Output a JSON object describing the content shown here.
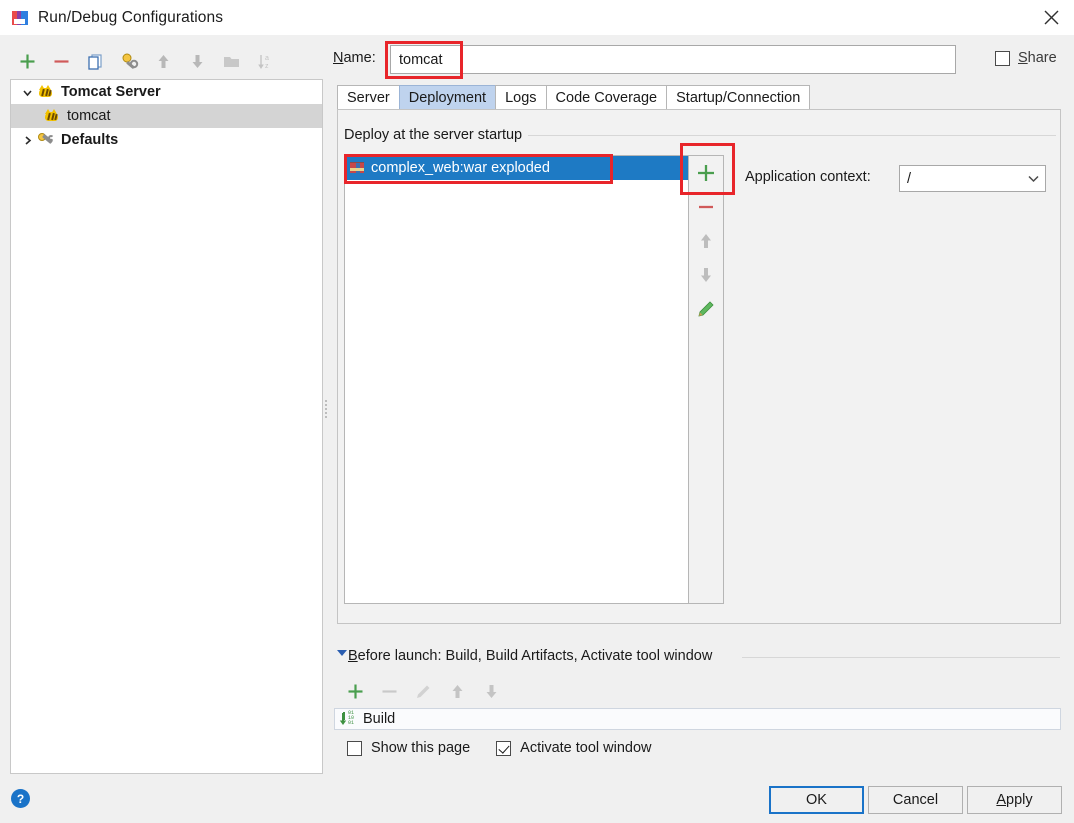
{
  "window": {
    "title": "Run/Debug Configurations",
    "icon": "intellij-icon",
    "close_label": "✕"
  },
  "left_toolbar": {
    "buttons": [
      {
        "name": "add-configuration-button",
        "icon": "plus-icon",
        "tip": "Add New Configuration"
      },
      {
        "name": "remove-configuration-button",
        "icon": "minus-icon",
        "tip": "Remove Configuration"
      },
      {
        "name": "copy-configuration-button",
        "icon": "copy-icon",
        "tip": "Copy Configuration"
      },
      {
        "name": "edit-defaults-button",
        "icon": "wrench-bulb-icon",
        "tip": "Edit defaults"
      },
      {
        "name": "move-up-button",
        "icon": "arrow-up-icon",
        "tip": "Move Up"
      },
      {
        "name": "move-down-button",
        "icon": "arrow-down-icon",
        "tip": "Move Down"
      },
      {
        "name": "create-folder-button",
        "icon": "folder-icon",
        "tip": "Create New Folder"
      },
      {
        "name": "sort-configurations-button",
        "icon": "sort-az-icon",
        "tip": "Sort Configurations"
      }
    ]
  },
  "tree": {
    "nodes": [
      {
        "label": "Tomcat Server",
        "icon": "tomcat-icon",
        "expanded": true,
        "bold": true,
        "indent": 0,
        "selected": false,
        "twisty": "⌄"
      },
      {
        "label": "tomcat",
        "icon": "tomcat-icon",
        "expanded": null,
        "bold": false,
        "indent": 1,
        "selected": true,
        "twisty": ""
      },
      {
        "label": "Defaults",
        "icon": "wrench-bulb-icon",
        "expanded": false,
        "bold": true,
        "indent": 0,
        "selected": false,
        "twisty": "›"
      }
    ]
  },
  "name_row": {
    "label_prefix": "",
    "label_mnemonic": "N",
    "label_suffix": "ame:",
    "value": "tomcat",
    "placeholder": ""
  },
  "share": {
    "label_mnemonic": "S",
    "label_suffix": "hare",
    "checked": false
  },
  "tabs": [
    {
      "label": "Server",
      "active": false
    },
    {
      "label": "Deployment",
      "active": true
    },
    {
      "label": "Logs",
      "active": false
    },
    {
      "label": "Code Coverage",
      "active": false
    },
    {
      "label": "Startup/Connection",
      "active": false
    }
  ],
  "deployment": {
    "group_title": "Deploy at the server startup",
    "items": [
      {
        "label": "complex_web:war exploded",
        "icon": "artifact-icon",
        "selected": true
      }
    ],
    "side_toolbar": [
      {
        "name": "add-artifact-button",
        "icon": "plus-icon",
        "enabled": true
      },
      {
        "name": "remove-artifact-button",
        "icon": "minus-icon",
        "enabled": true
      },
      {
        "name": "move-artifact-up-button",
        "icon": "arrow-up-icon",
        "enabled": false
      },
      {
        "name": "move-artifact-down-button",
        "icon": "arrow-down-icon",
        "enabled": false
      },
      {
        "name": "edit-artifact-button",
        "icon": "pencil-icon",
        "enabled": true
      }
    ],
    "application_context": {
      "label": "Application context:",
      "value": "/",
      "options": [
        "/"
      ]
    }
  },
  "before_launch": {
    "twisty": "▾",
    "title_mnemonic": "B",
    "title_suffix": "efore launch: Build, Build Artifacts, Activate tool window",
    "toolbar": [
      {
        "name": "add-task-button",
        "icon": "plus-icon",
        "enabled": true
      },
      {
        "name": "remove-task-button",
        "icon": "minus-icon",
        "enabled": false
      },
      {
        "name": "edit-task-button",
        "icon": "pencil-icon",
        "enabled": false
      },
      {
        "name": "move-task-up-button",
        "icon": "arrow-up-icon",
        "enabled": false
      },
      {
        "name": "move-task-down-button",
        "icon": "arrow-down-icon",
        "enabled": false
      }
    ],
    "tasks": [
      {
        "label": "Build",
        "icon": "build-icon"
      }
    ],
    "checkboxes": [
      {
        "name": "show-this-page-checkbox",
        "label": "Show this page",
        "checked": false
      },
      {
        "name": "activate-tool-window-checkbox",
        "label": "Activate tool window",
        "checked": true
      }
    ]
  },
  "footer": {
    "help_glyph": "?",
    "ok": {
      "label": "OK",
      "default": true
    },
    "cancel": {
      "label": "Cancel",
      "default": false
    },
    "apply": {
      "label_mnemonic": "A",
      "label_suffix": "pply",
      "default": false
    }
  },
  "annotations": [
    {
      "name": "name-field-highlight",
      "color": "#e8252a"
    },
    {
      "name": "deployment-item-highlight",
      "color": "#e8252a"
    },
    {
      "name": "add-artifact-highlight",
      "color": "#e8252a"
    }
  ]
}
